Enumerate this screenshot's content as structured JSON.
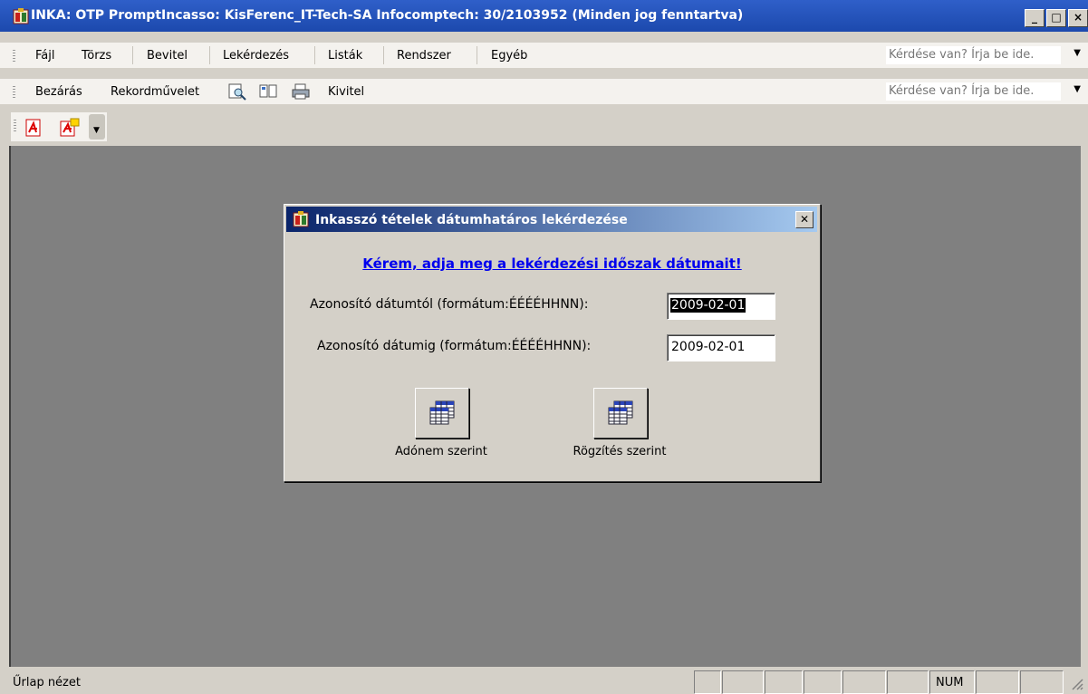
{
  "window": {
    "title": "INKA: OTP PromptIncasso: KisFerenc_IT-Tech-SA Infocomptech: 30/2103952 (Minden jog fenntartva)",
    "buttons": [
      "_",
      "□",
      "×"
    ]
  },
  "menubar": {
    "items": [
      "Fájl",
      "Törzs",
      "Bevitel",
      "Lekérdezés",
      "Listák",
      "Rendszer",
      "Egyéb"
    ],
    "help_placeholder": "Kérdése van? Írja be ide."
  },
  "toolbar": {
    "close_label": "Bezárás",
    "record_label": "Rekordművelet",
    "export_label": "Kivitel",
    "help_placeholder": "Kérdése van? Írja be ide."
  },
  "iconbar": {
    "icons": [
      "pdf-icon",
      "pdf-options-icon",
      "toolbar-options-icon"
    ]
  },
  "dialog": {
    "title": "Inkasszó tételek dátumhatáros lekérdezése",
    "prompt": "Kérem, adja meg a lekérdezési időszak dátumait!",
    "from_label": "Azonosító dátumtól (formátum:ÉÉÉÉHHNN):",
    "from_value": "2009-02-01",
    "to_label": "Azonosító dátumig (formátum:ÉÉÉÉHHNN):",
    "to_value": "2009-02-01",
    "button1_label": "Adónem szerint",
    "button2_label": "Rögzítés szerint"
  },
  "statusbar": {
    "text": "Űrlap nézet",
    "num": "NUM"
  }
}
